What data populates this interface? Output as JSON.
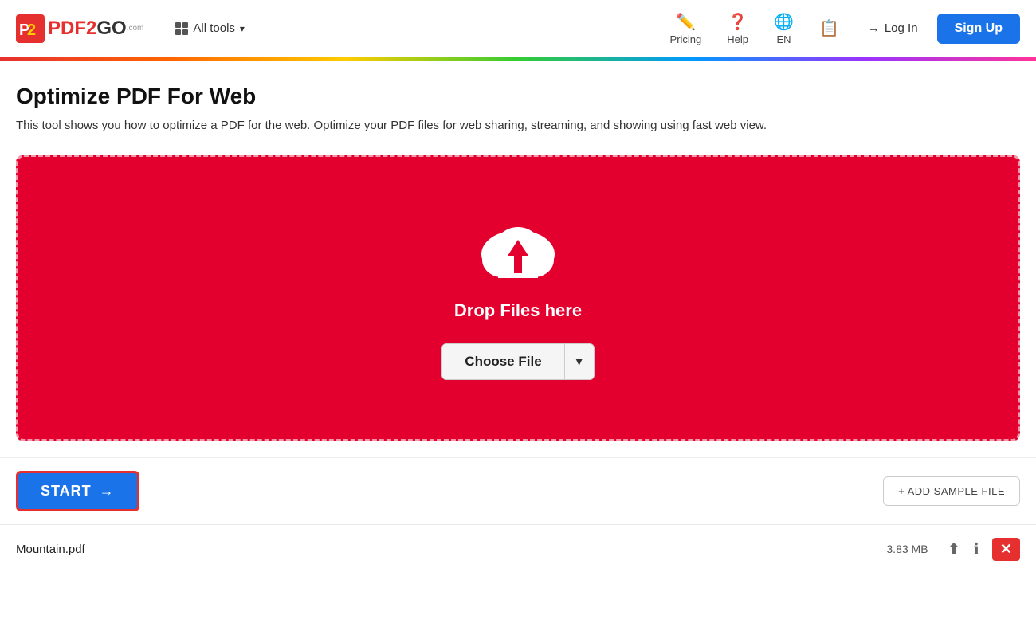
{
  "logo": {
    "text_pdf": "PDF",
    "text_2": "2",
    "text_go": "GO",
    "text_com": ".com"
  },
  "header": {
    "all_tools_label": "All tools",
    "nav": [
      {
        "id": "pricing",
        "label": "Pricing",
        "icon": "✏️"
      },
      {
        "id": "help",
        "label": "Help",
        "icon": "❓"
      },
      {
        "id": "language",
        "label": "EN",
        "icon": "🌐"
      },
      {
        "id": "history",
        "label": "",
        "icon": "📋"
      }
    ],
    "login_label": "Log In",
    "signup_label": "Sign Up"
  },
  "page": {
    "title": "Optimize PDF For Web",
    "description": "This tool shows you how to optimize a PDF for the web. Optimize your PDF files for web sharing, streaming, and showing using fast web view."
  },
  "dropzone": {
    "drop_text": "Drop Files here",
    "choose_file_label": "Choose File",
    "choose_file_arrow": "▾"
  },
  "toolbar": {
    "start_label": "START",
    "start_arrow": "→",
    "add_sample_label": "+ ADD SAMPLE FILE"
  },
  "file": {
    "name": "Mountain.pdf",
    "size": "3.83 MB"
  }
}
